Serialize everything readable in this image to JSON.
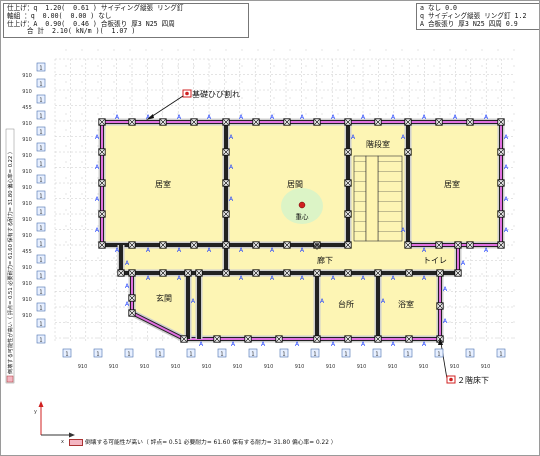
{
  "info_left": {
    "line1": "仕上げ：q  1.20(  0.61 ) サイディング縦張 リング釘",
    "line2": "軸組 ：q  0.00(  0.00 ) なし",
    "line3": "仕上げ：A  0.90(  0.46 ) 合板張り 厚3 N25 四周",
    "line4": "     合 計  2.10( kN/m )(  1.07 )"
  },
  "info_right": {
    "line1": "a なし 0.0",
    "line2": "q サイディング縦張 リング釘 1.2",
    "line3": "A 合板張り 厚3 N25 四周 0.9"
  },
  "rooms": {
    "living1": "居室",
    "living_main": "居間",
    "stairs": "階段室",
    "living2": "居室",
    "corridor": "廊下",
    "toilet": "トイレ",
    "entrance": "玄関",
    "kitchen": "台所",
    "bath": "浴室",
    "center_of_gravity": "重心"
  },
  "annotations": {
    "foundation_crack": "基礎ひび割れ",
    "second_floor_under": "２階床下"
  },
  "dims": {
    "marker": "1",
    "span_label": "910",
    "y_labels": [
      "910",
      "910",
      "455",
      "910",
      "910",
      "910",
      "910",
      "910",
      "910",
      "910",
      "910",
      "455",
      "910",
      "910",
      "910",
      "910"
    ]
  },
  "status": {
    "text": "倒壊する可能性が高い（ 評点= 0.51  必要耐力= 61.60  保有する耐力= 31.80  偏心率= 0.22 ）",
    "color": "#f4b6c2"
  },
  "axis": {
    "y": "y",
    "x": "x"
  },
  "colors": {
    "room_fill": "#fdf5b4",
    "wall_dark": "#222222",
    "wall_finish": "#e070e0",
    "wall_light": "#cfcfcf",
    "marker_blue": "#1a3cff",
    "alert_red": "#d02020"
  }
}
